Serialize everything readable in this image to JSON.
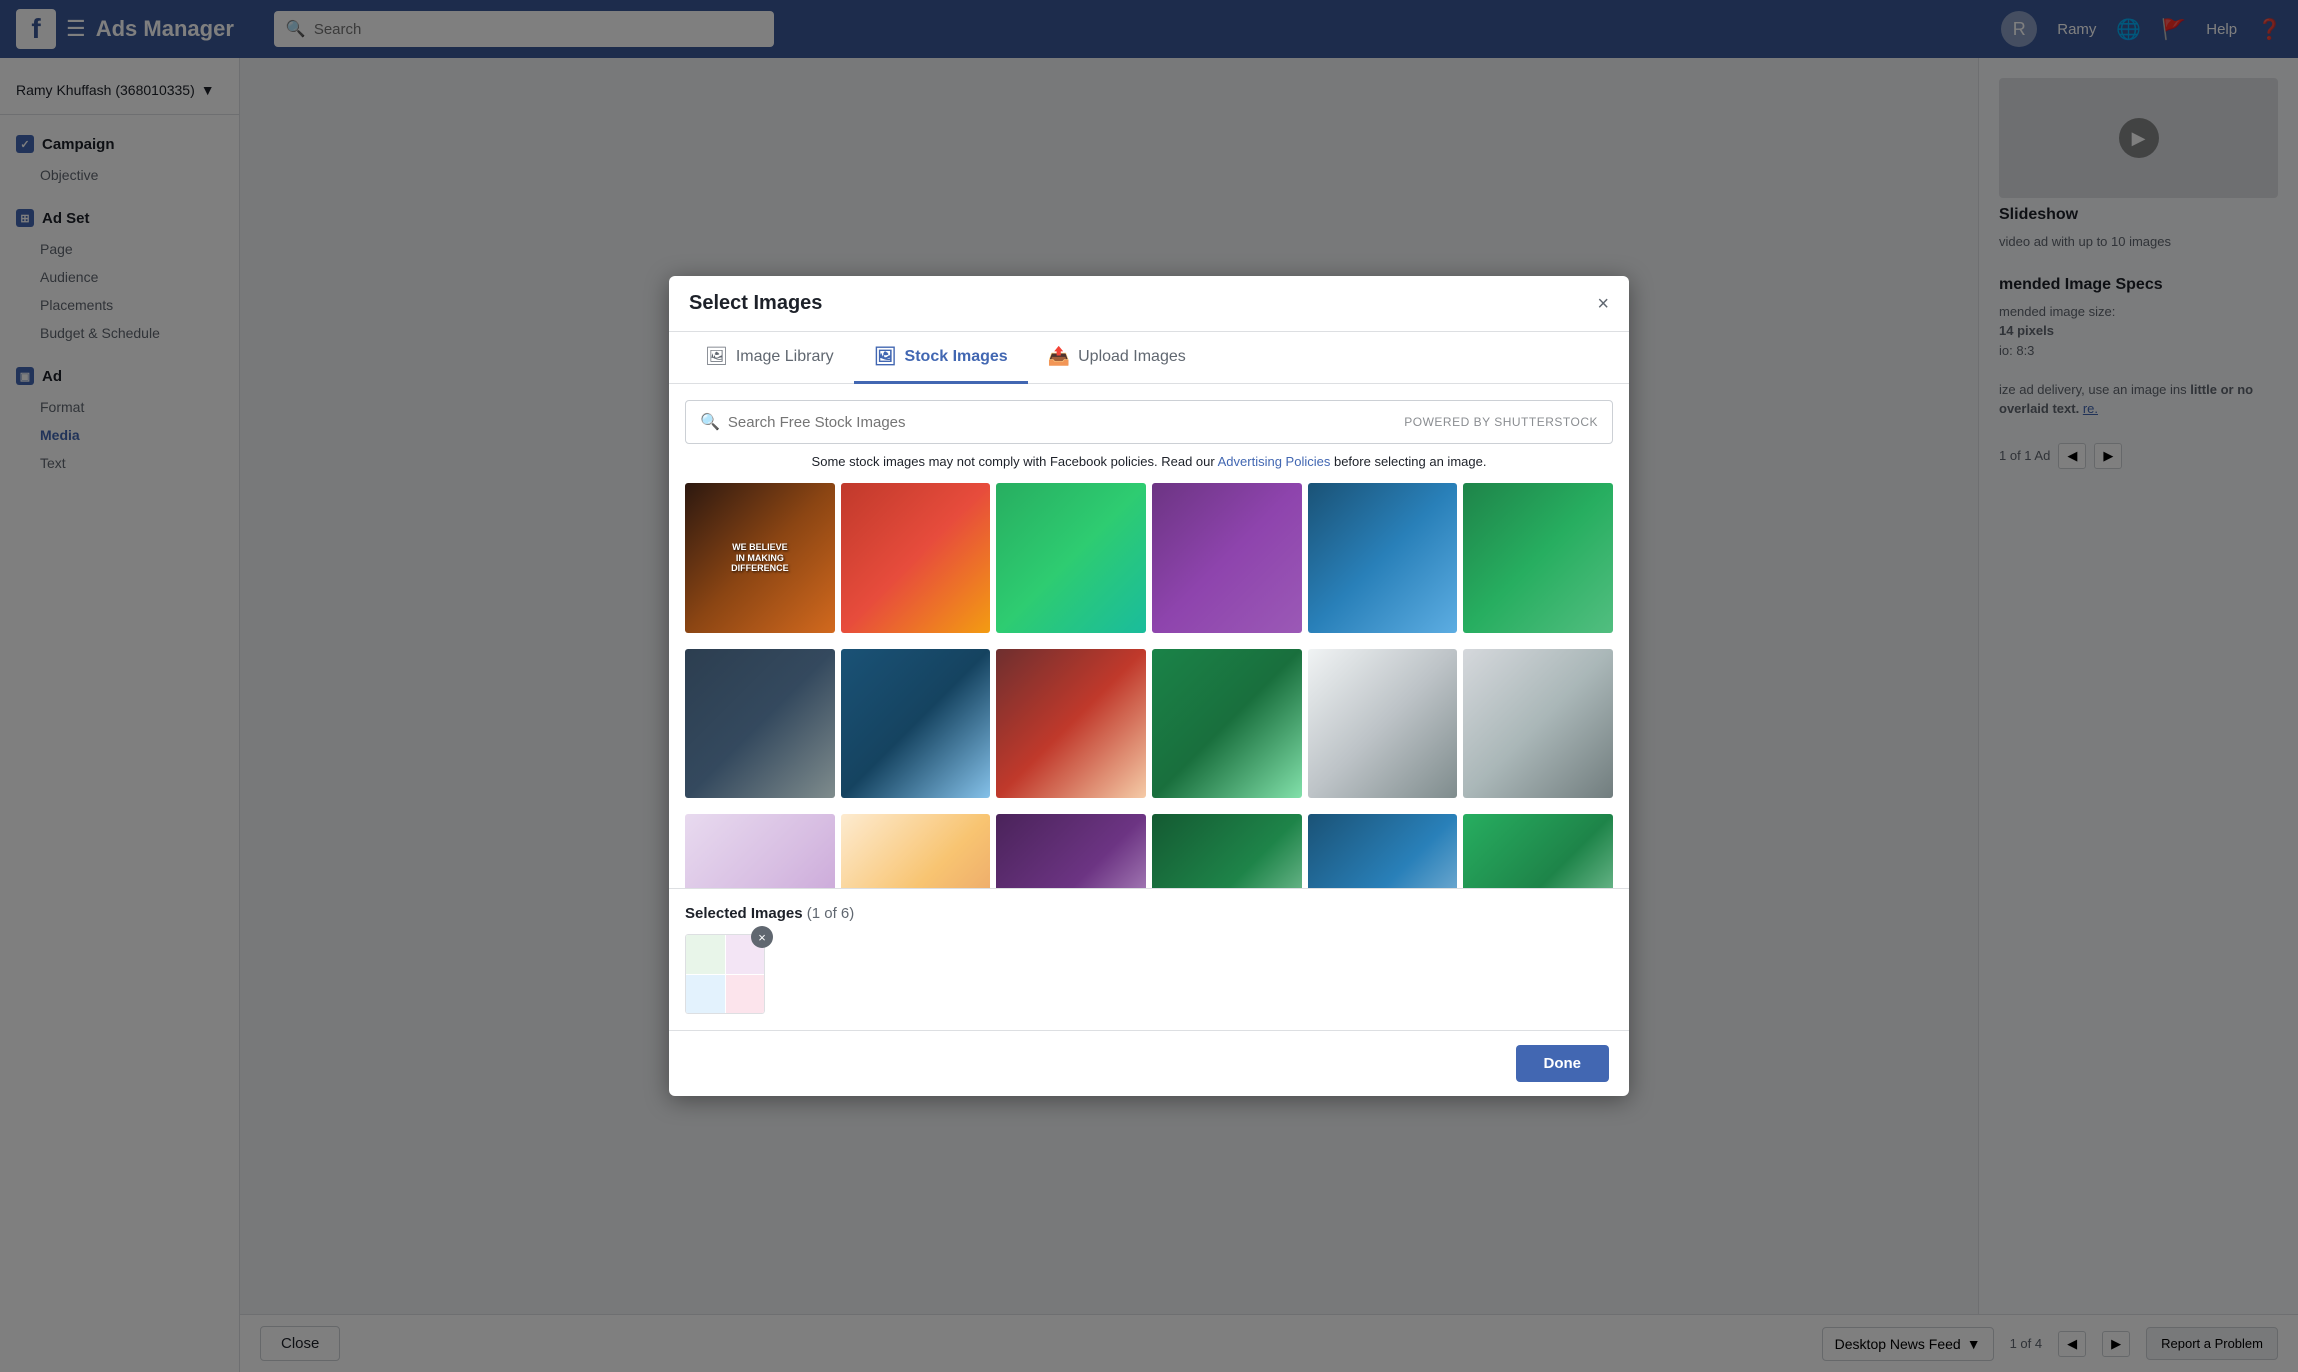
{
  "navbar": {
    "title": "Ads Manager",
    "search_placeholder": "Search",
    "username": "Ramy",
    "help_label": "Help"
  },
  "sidebar": {
    "account_label": "Ramy Khuffash (368010335)",
    "sections": [
      {
        "title": "Campaign",
        "items": [
          "Objective"
        ]
      },
      {
        "title": "Ad Set",
        "items": [
          "Page",
          "Audience",
          "Placements",
          "Budget & Schedule"
        ]
      },
      {
        "title": "Ad",
        "items": [
          "Format",
          "Media",
          "Text"
        ],
        "active_item": "Media"
      }
    ]
  },
  "modal": {
    "title": "Select Images",
    "close_label": "×",
    "tabs": [
      {
        "label": "Image Library",
        "icon": "image-icon",
        "active": false
      },
      {
        "label": "Stock Images",
        "icon": "stock-icon",
        "active": true
      },
      {
        "label": "Upload Images",
        "icon": "upload-icon",
        "active": false
      }
    ],
    "search_placeholder": "Search Free Stock Images",
    "search_powered": "POWERED BY SHUTTERSTOCK",
    "warning_text": "Some stock images may not comply with Facebook policies. Read our ",
    "warning_link": "Advertising Policies",
    "warning_suffix": " before selecting an image.",
    "selected_label": "Selected Images",
    "selected_count": "(1 of 6)",
    "done_label": "Done"
  },
  "right_panel": {
    "slideshow_title": "Slideshow",
    "slideshow_text": "video ad with up to 10 images",
    "specs_title": "mended Image Specs",
    "specs_size_label": "mended image size:",
    "specs_size_value": "14 pixels",
    "specs_ratio_label": "io: 8:3",
    "specs_note": "ize ad delivery, use an image ins ",
    "specs_bold": "little or no overlaid text.",
    "specs_link": "re.",
    "ad_count": "1 of 1 Ad",
    "page_count": "1 of 4"
  },
  "bottom": {
    "close_label": "Close",
    "news_feed_label": "Desktop News Feed",
    "report_label": "Report a Problem"
  },
  "images": {
    "row1": [
      {
        "class": "img-community1",
        "text": "WE BELIEVE IN MAKING DIFFERENCE"
      },
      {
        "class": "img-community2",
        "text": ""
      },
      {
        "class": "img-community3",
        "text": ""
      },
      {
        "class": "img-community4",
        "text": ""
      },
      {
        "class": "img-community5",
        "text": ""
      },
      {
        "class": "img-community6",
        "text": ""
      }
    ],
    "row2": [
      {
        "class": "img-row2a",
        "text": ""
      },
      {
        "class": "img-row2b",
        "text": ""
      },
      {
        "class": "img-row2c",
        "text": ""
      },
      {
        "class": "img-row2d",
        "text": ""
      },
      {
        "class": "img-row2e",
        "text": ""
      },
      {
        "class": "img-row2f",
        "text": ""
      }
    ],
    "row3": [
      {
        "class": "img-row3a",
        "text": ""
      },
      {
        "class": "img-row3b",
        "text": ""
      },
      {
        "class": "img-row3c",
        "text": ""
      },
      {
        "class": "img-row3d",
        "text": ""
      },
      {
        "class": "img-row3e",
        "text": ""
      },
      {
        "class": "img-row3f",
        "text": ""
      }
    ],
    "row4": [
      {
        "class": "img-row4a",
        "text": ""
      },
      {
        "class": "img-row4b",
        "text": ""
      },
      {
        "class": "img-row4c",
        "text": ""
      },
      {
        "class": "img-row4d",
        "text": ""
      },
      {
        "class": "img-row4e",
        "text": ""
      },
      {
        "class": "img-row4f",
        "text": ""
      }
    ]
  }
}
